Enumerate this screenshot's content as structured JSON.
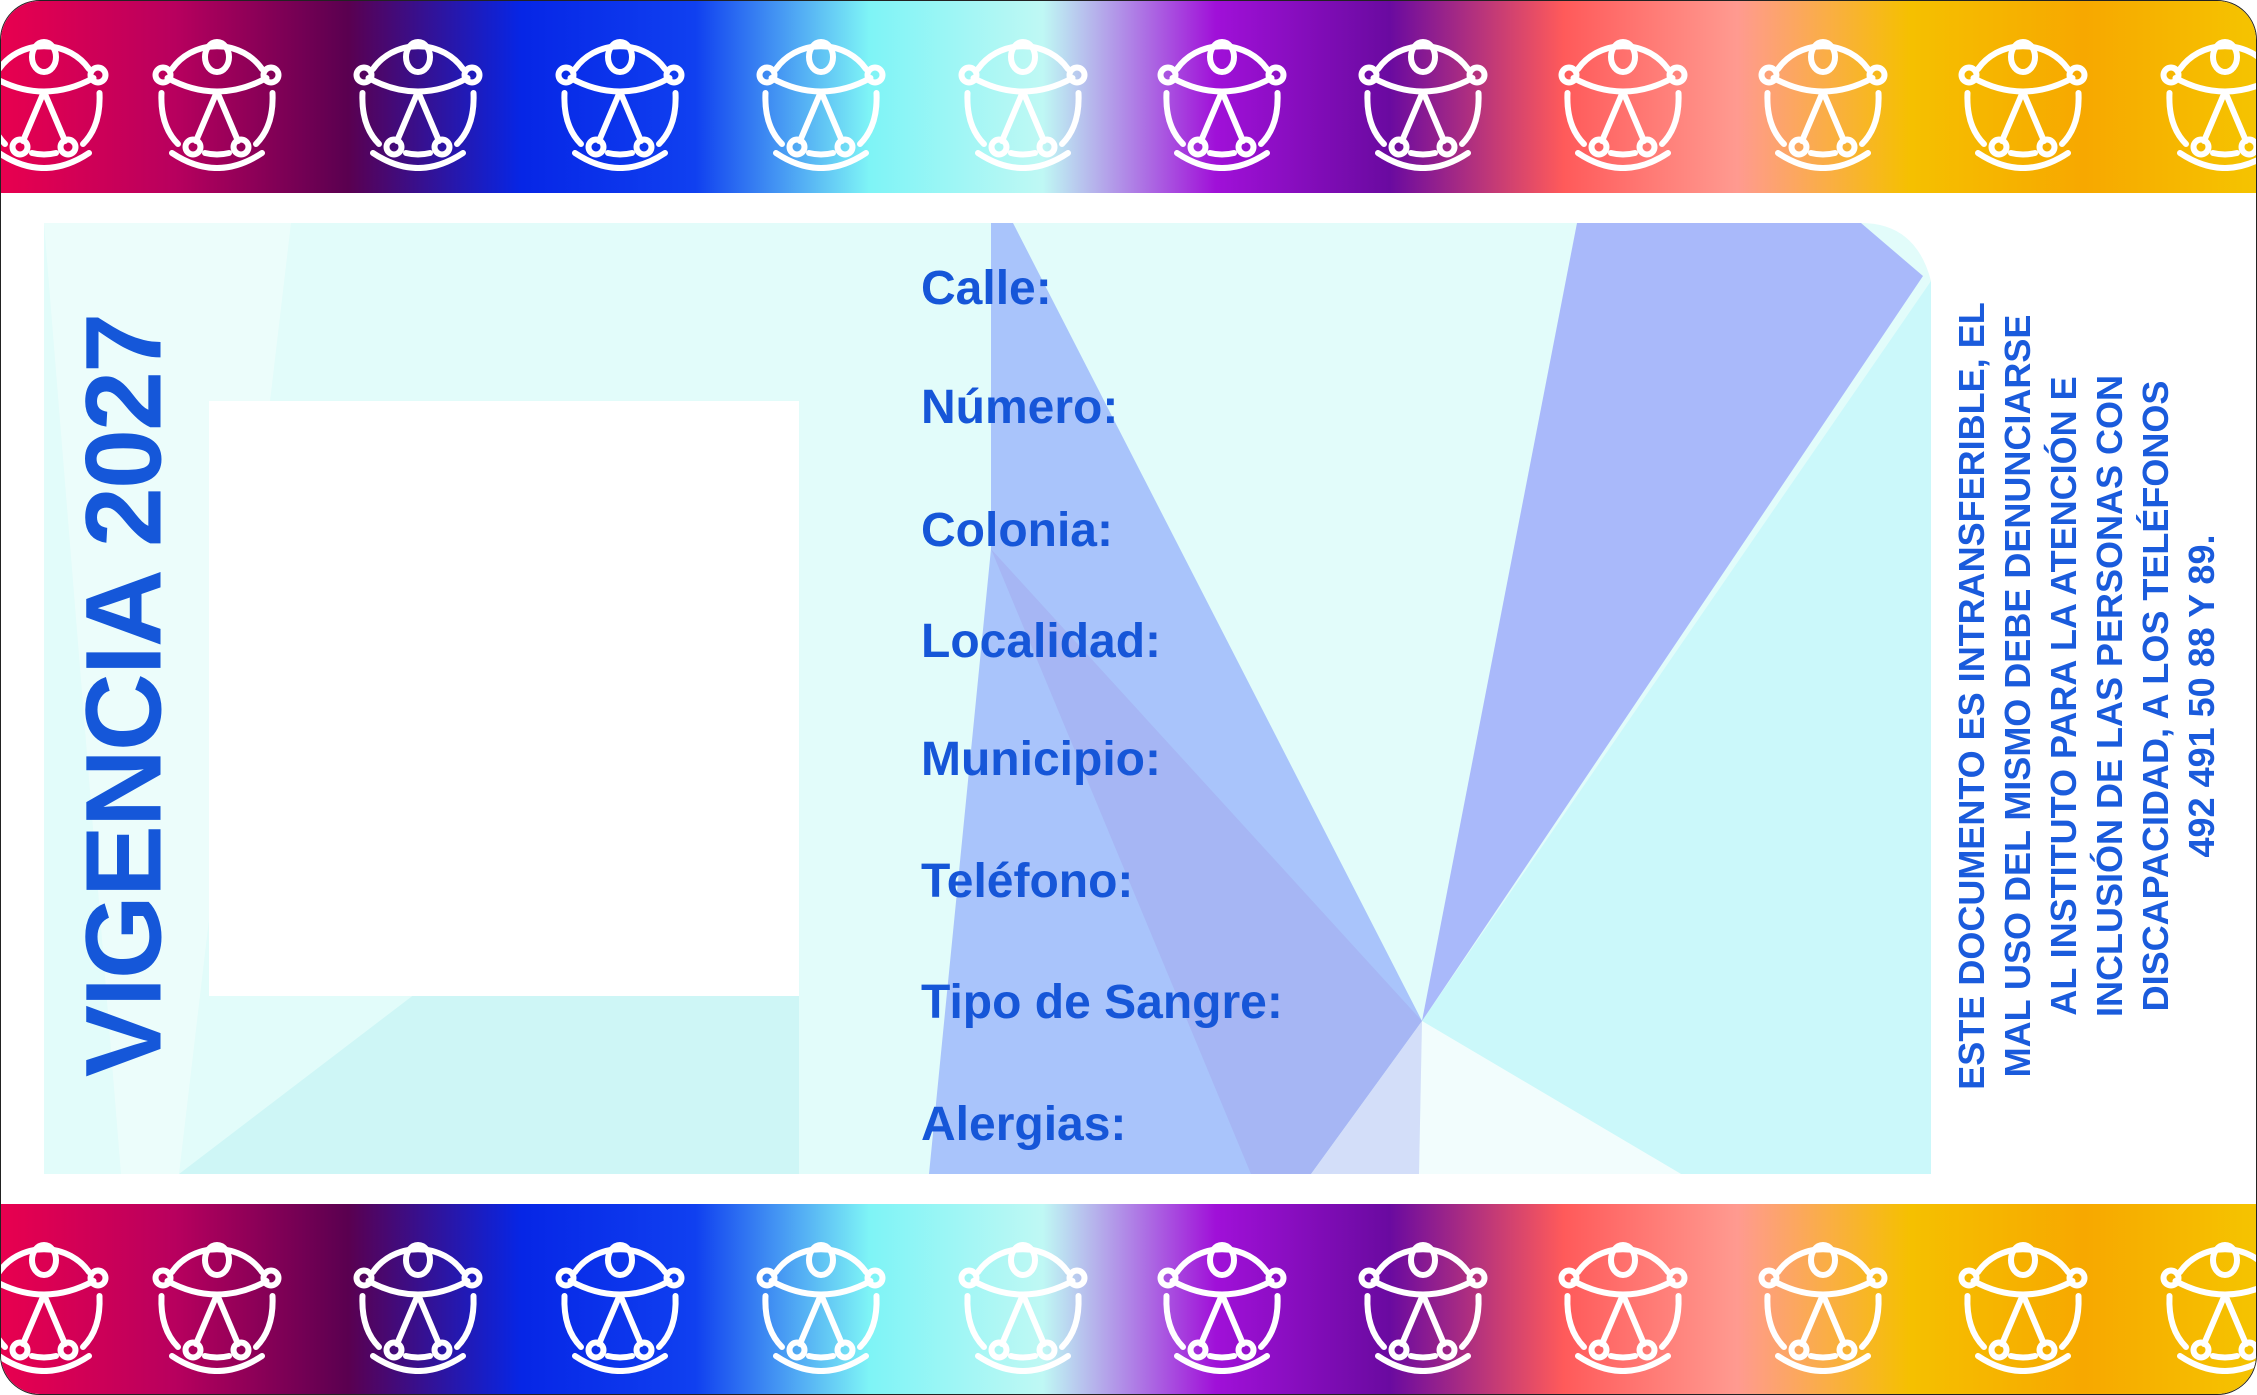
{
  "validity": "VIGENCIA 2027",
  "fields": [
    "Calle:",
    "Número:",
    "Colonia:",
    "Localidad:",
    "Municipio:",
    "Teléfono:",
    "Tipo de Sangre:",
    "Alergias:"
  ],
  "notice_lines": [
    "ESTE DOCUMENTO ES INTRANSFERIBLE, EL",
    "MAL USO DEL MISMO DEBE DENUNCIARSE",
    "AL INSTITUTO PARA LA ATENCIÓN E",
    "INCLUSIÓN DE LAS PERSONAS CON",
    "DISCAPACIDAD, A LOS TELÉFONOS",
    "492 491 50 88 Y 89."
  ],
  "banner": {
    "icon": "accessibility-icon",
    "colors": [
      "#e8004f",
      "#b8005e",
      "#5a0050",
      "#0626e6",
      "#1040f0",
      "#7ef4f6",
      "#bff8f4",
      "#a010d8",
      "#6a0aa0",
      "#ff5a5a",
      "#ff9a90",
      "#f5c000",
      "#f7a800",
      "#f5c400"
    ]
  },
  "colors": {
    "text": "#1656d8",
    "panel": "#e2fcfa",
    "wedge": "#a9b8fa"
  }
}
